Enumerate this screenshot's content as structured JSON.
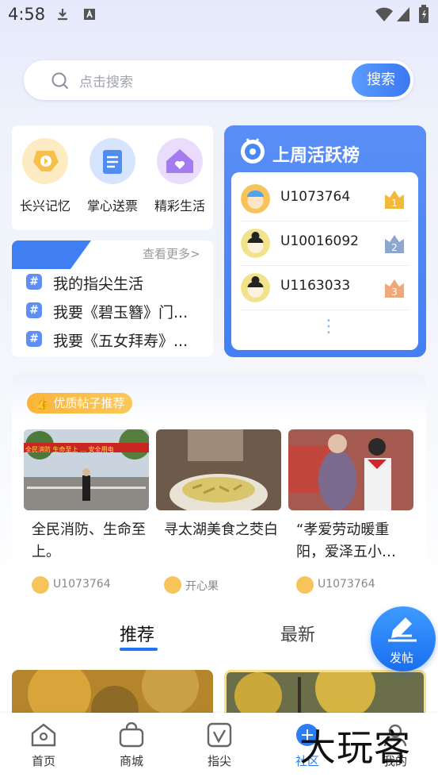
{
  "status_bar": {
    "time": "4:58"
  },
  "search": {
    "placeholder": "点击搜索",
    "button": "搜索"
  },
  "quick_links": [
    {
      "label": "长兴记忆",
      "icon": "memory-play-icon",
      "color": "#f7c04a"
    },
    {
      "label": "掌心送票",
      "icon": "ticket-icon",
      "color": "#4f8cf3"
    },
    {
      "label": "精彩生活",
      "icon": "home-heart-icon",
      "color": "#a47cf0"
    }
  ],
  "topics": {
    "more": "查看更多>",
    "items": [
      "我的指尖生活",
      "我要《碧玉簪》门...",
      "我要《五女拜寿》..."
    ]
  },
  "leaderboard": {
    "title": "上周活跃榜",
    "rows": [
      {
        "user": "U1073764",
        "rank": "1",
        "color": "#f4b93a"
      },
      {
        "user": "U10016092",
        "rank": "2",
        "color": "#8ea7cf"
      },
      {
        "user": "U1163033",
        "rank": "3",
        "color": "#f0a77a"
      }
    ],
    "more_dots": "⋮"
  },
  "posts": {
    "badge": "优质帖子推荐",
    "items": [
      {
        "title": "全民消防、生命至上。",
        "author": "U1073764",
        "banner": "全民消防 生命至上 … 安全用电"
      },
      {
        "title": "寻太湖美食之茭白",
        "author": "开心果"
      },
      {
        "title": "“孝爱劳动暖重阳，爱泽五小…",
        "author": "U1073764"
      }
    ]
  },
  "feed_tabs": {
    "recommend": "推荐",
    "latest": "最新"
  },
  "fab": {
    "label": "发帖"
  },
  "bottom_nav": [
    {
      "label": "首页",
      "icon": "home-icon"
    },
    {
      "label": "商城",
      "icon": "shop-bag-icon"
    },
    {
      "label": "指尖",
      "icon": "fingertip-icon"
    },
    {
      "label": "社区",
      "icon": "community-icon"
    },
    {
      "label": "我的",
      "icon": "profile-icon"
    }
  ],
  "watermark": "大玩客",
  "colors": {
    "accent": "#1e77f0",
    "active_nav": "#2f7df4"
  }
}
